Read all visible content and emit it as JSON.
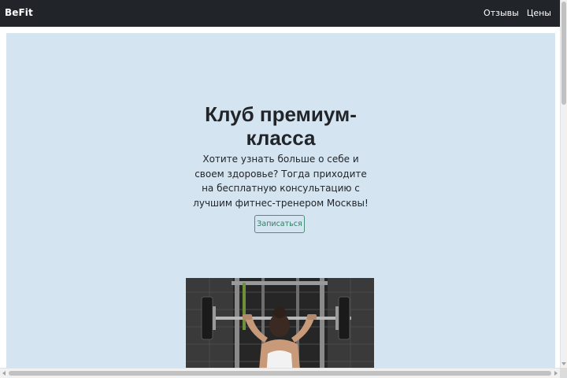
{
  "navbar": {
    "brand": "BeFit",
    "links": [
      "Отзывы",
      "Цены"
    ],
    "background": "#212529"
  },
  "hero": {
    "title_line1": "Клуб премиум-",
    "title_line2": "класса",
    "text": "Хотите узнать больше о себе и своем здоровье? Тогда приходите на бесплатную консультацию с лучшим фитнес-тренером Москвы!",
    "button_label": "Записаться",
    "background": "#d5e4f1",
    "accent": "#2f7c62"
  },
  "image": {
    "subject": "woman-lifting-barbell-photo"
  }
}
